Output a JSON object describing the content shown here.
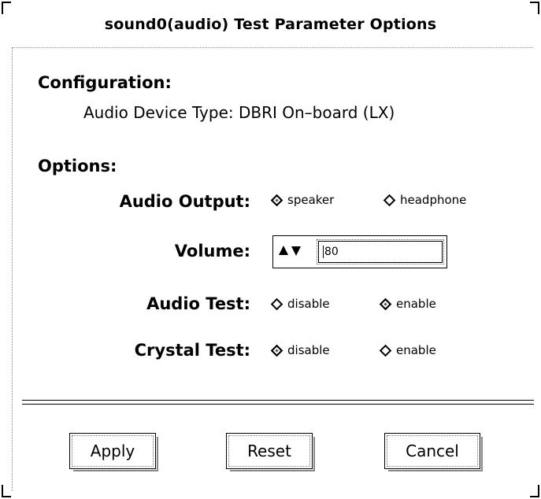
{
  "window": {
    "title": "sound0(audio) Test Parameter Options"
  },
  "configuration": {
    "heading": "Configuration:",
    "device_type": "Audio Device Type: DBRI On–board (LX)"
  },
  "options": {
    "heading": "Options:",
    "audio_output": {
      "label": "Audio Output:",
      "choices": [
        {
          "label": "speaker",
          "selected": true
        },
        {
          "label": "headphone",
          "selected": false
        }
      ]
    },
    "volume": {
      "label": "Volume:",
      "value": "80"
    },
    "audio_test": {
      "label": "Audio Test:",
      "choices": [
        {
          "label": "disable",
          "selected": false
        },
        {
          "label": "enable",
          "selected": true
        }
      ]
    },
    "crystal_test": {
      "label": "Crystal Test:",
      "choices": [
        {
          "label": "disable",
          "selected": true
        },
        {
          "label": "enable",
          "selected": false
        }
      ]
    }
  },
  "buttons": {
    "apply": "Apply",
    "reset": "Reset",
    "cancel": "Cancel"
  }
}
